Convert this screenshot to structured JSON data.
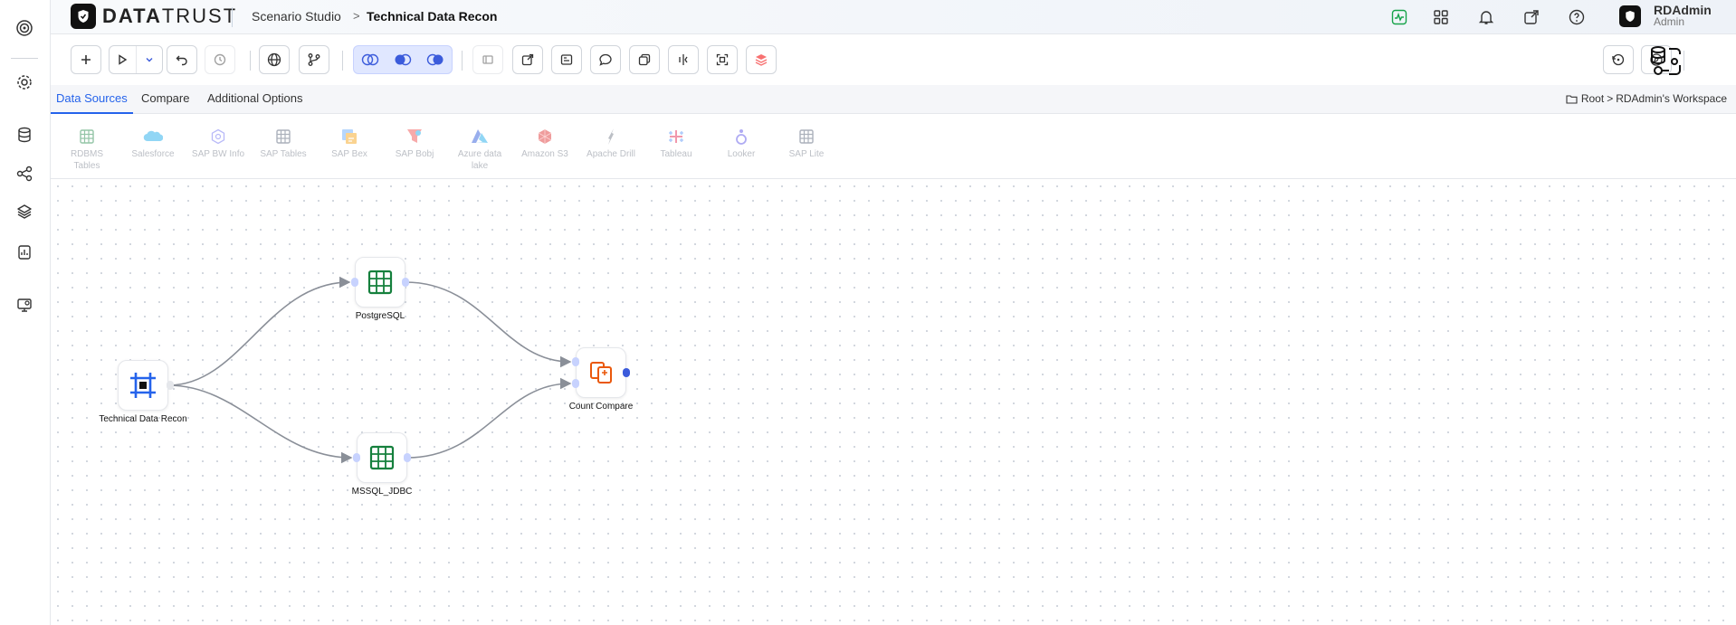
{
  "app": {
    "logo_text_bold": "DATA",
    "logo_text_rest": "TRUST",
    "breadcrumb": [
      "Scenario Studio",
      "Technical Data Recon"
    ],
    "breadcrumb_separator": ">"
  },
  "user": {
    "name": "RDAdmin",
    "role": "Admin"
  },
  "sidebar": {
    "items": [
      {
        "icon": "target-icon"
      },
      {
        "icon": "settings-icon"
      },
      {
        "icon": "database-icon"
      },
      {
        "icon": "workflow-icon"
      },
      {
        "icon": "layers-icon"
      },
      {
        "icon": "report-icon"
      },
      {
        "icon": "monitor-settings-icon"
      }
    ]
  },
  "header_icons": [
    "activity-icon",
    "apps-grid-icon",
    "bell-icon",
    "external-link-icon",
    "help-icon"
  ],
  "tabs": [
    {
      "label": "Data Sources",
      "active": true
    },
    {
      "label": "Compare",
      "active": false
    },
    {
      "label": "Additional Options",
      "active": false
    }
  ],
  "workspace": {
    "root": "Root",
    "separator": ">",
    "name": "RDAdmin's Workspace"
  },
  "data_sources": [
    {
      "label": "RDBMS Tables"
    },
    {
      "label": "Salesforce"
    },
    {
      "label": "SAP BW Info"
    },
    {
      "label": "SAP Tables"
    },
    {
      "label": "SAP Bex"
    },
    {
      "label": "SAP Bobj"
    },
    {
      "label": "Azure data lake"
    },
    {
      "label": "Amazon S3"
    },
    {
      "label": "Apache Drill"
    },
    {
      "label": "Tableau"
    },
    {
      "label": "Looker"
    },
    {
      "label": "SAP Lite"
    }
  ],
  "flow": {
    "nodes": [
      {
        "id": "source",
        "label": "Technical Data Recon"
      },
      {
        "id": "pg",
        "label": "PostgreSQL"
      },
      {
        "id": "mssql",
        "label": "MSSQL_JDBC"
      },
      {
        "id": "compare",
        "label": "Count Compare"
      }
    ]
  },
  "colors": {
    "accent": "#2563eb",
    "table_icon": "#15803d",
    "compare_icon": "#ea580c",
    "source_icon": "#2563eb"
  }
}
